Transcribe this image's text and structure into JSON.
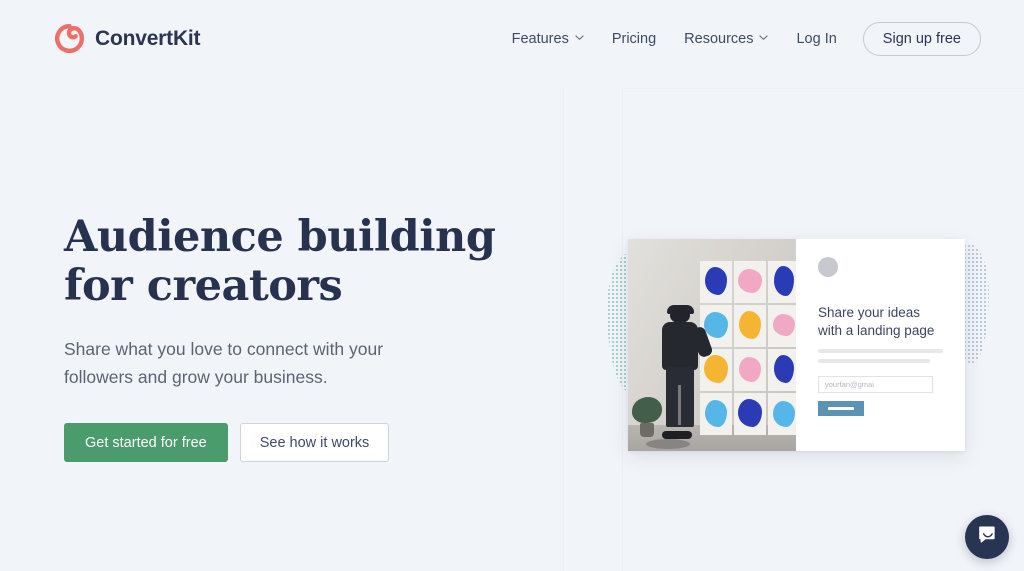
{
  "brand": {
    "name": "ConvertKit",
    "logo_icon": "convertkit-swirl-icon",
    "logo_color": "#ef6f68",
    "text_color": "#2b3553"
  },
  "nav": {
    "items": [
      {
        "label": "Features",
        "has_dropdown": true,
        "icon": "chevron-down-icon"
      },
      {
        "label": "Pricing",
        "has_dropdown": false
      },
      {
        "label": "Resources",
        "has_dropdown": true,
        "icon": "chevron-down-icon"
      },
      {
        "label": "Log In",
        "has_dropdown": false
      }
    ],
    "signup_label": "Sign up free"
  },
  "hero": {
    "headline_line1": "Audience building",
    "headline_line2": "for creators",
    "subhead_line1": "Share what you love to connect with your",
    "subhead_line2": "followers and grow your business.",
    "primary_cta": "Get started for free",
    "secondary_cta": "See how it works",
    "primary_cta_color": "#4a9c6d"
  },
  "hero_card": {
    "photo_alt": "person-adding-art-prints-to-wall",
    "avatar_icon": "avatar-placeholder-icon",
    "lp_title_line1": "Share your ideas",
    "lp_title_line2": "with a landing page",
    "email_value": "yourfan@gmai",
    "submit_button_color": "#5b93b3",
    "decor_left": "teal-dotted-blob",
    "decor_right": "blue-dotted-blob"
  },
  "chat": {
    "icon": "chat-bubble-smile-icon",
    "color": "#273452"
  }
}
